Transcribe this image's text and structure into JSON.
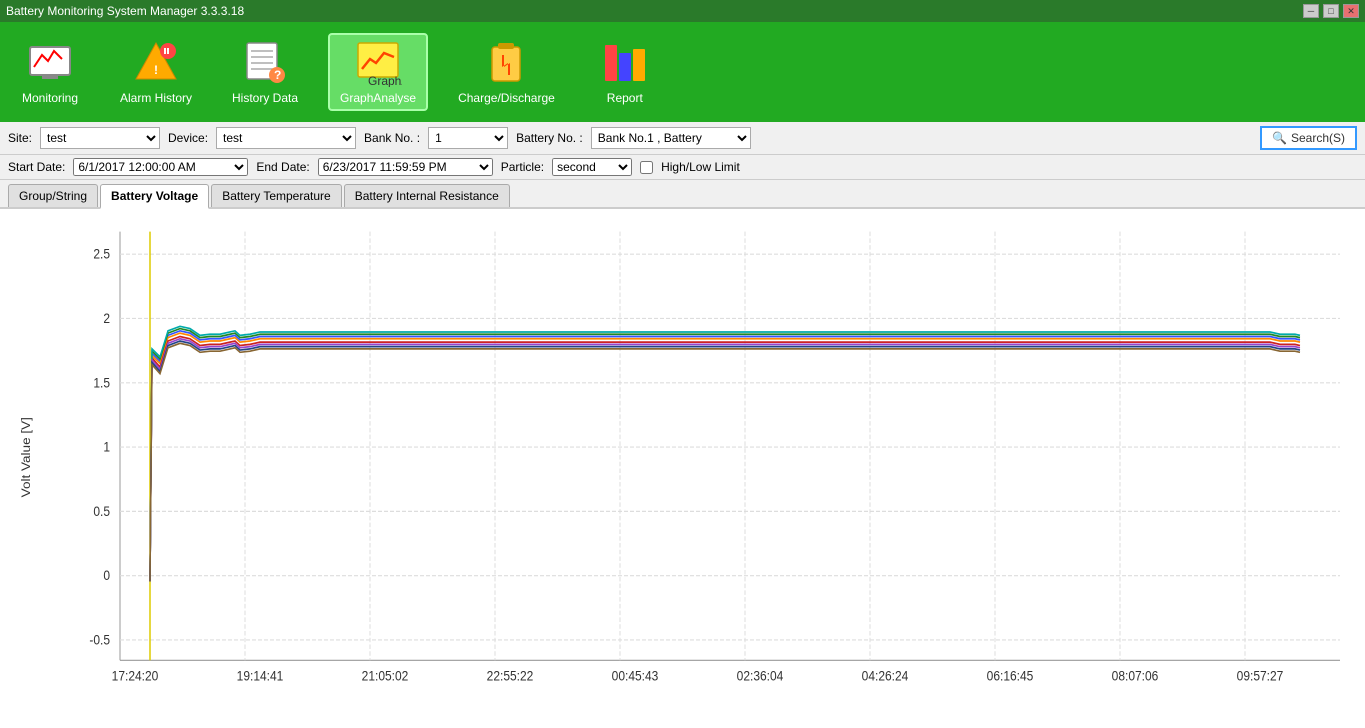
{
  "titlebar": {
    "title": "Battery Monitoring System Manager 3.3.3.18",
    "controls": [
      "minimize",
      "maximize",
      "close"
    ]
  },
  "toolbar": {
    "items": [
      {
        "id": "monitoring",
        "label": "Monitoring",
        "icon": "📊",
        "active": false
      },
      {
        "id": "alarm-history",
        "label": "Alarm History",
        "icon": "🔔",
        "active": false
      },
      {
        "id": "history-data",
        "label": "History Data",
        "icon": "📋",
        "active": false
      },
      {
        "id": "graph-analyse",
        "label": "GraphAnalyse",
        "icon": "⚡",
        "active": true
      },
      {
        "id": "charge-discharge",
        "label": "Charge/Discharge",
        "icon": "🔋",
        "active": false
      },
      {
        "id": "report",
        "label": "Report",
        "icon": "📚",
        "active": false
      }
    ]
  },
  "controls": {
    "site_label": "Site:",
    "site_value": "test",
    "device_label": "Device:",
    "device_value": "test",
    "bank_no_label": "Bank No. :",
    "bank_no_value": "1",
    "battery_no_label": "Battery No. :",
    "battery_no_value": "Bank No.1 , Battery",
    "start_date_label": "Start Date:",
    "start_date_value": "6/1/2017 12:00:00 AM",
    "end_date_label": "End Date:",
    "end_date_value": "6/23/2017 11:59:59 PM",
    "particle_label": "Particle:",
    "particle_value": "second",
    "high_low_limit_label": "High/Low Limit",
    "search_label": "Search(S)"
  },
  "tabs": [
    {
      "id": "group-string",
      "label": "Group/String",
      "active": false
    },
    {
      "id": "battery-voltage",
      "label": "Battery Voltage",
      "active": true
    },
    {
      "id": "battery-temperature",
      "label": "Battery Temperature",
      "active": false
    },
    {
      "id": "battery-internal-resistance",
      "label": "Battery Internal Resistance",
      "active": false
    }
  ],
  "chart": {
    "y_axis_label": "Volt Value [V]",
    "y_ticks": [
      "2.5",
      "2",
      "1.5",
      "1",
      "0.5",
      "0",
      "-0.5"
    ],
    "x_ticks": [
      "17:24:20",
      "19:14:41",
      "21:05:02",
      "22:55:22",
      "00:45:43",
      "02:36:04",
      "04:26:24",
      "06:16:45",
      "08:07:06",
      "09:57:27"
    ]
  }
}
